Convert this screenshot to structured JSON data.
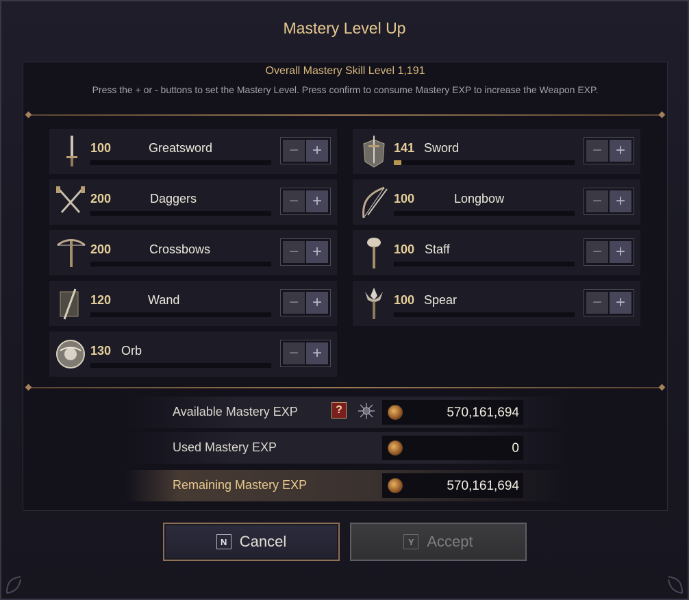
{
  "dialog": {
    "title": "Mastery Level Up",
    "overall_label": "Overall Mastery Skill Level 1,191",
    "description": "Press the + or - buttons to set the Mastery Level. Press confirm to consume Mastery EXP to increase the Weapon EXP."
  },
  "weapons": [
    {
      "level": "100",
      "name": "Greatsword",
      "icon": "greatsword-icon",
      "progress": 0
    },
    {
      "level": "141",
      "name": "Sword",
      "icon": "sword-icon",
      "progress": 0.04
    },
    {
      "level": "200",
      "name": "Daggers",
      "icon": "daggers-icon",
      "progress": 0
    },
    {
      "level": "100",
      "name": "Longbow",
      "icon": "longbow-icon",
      "progress": 0
    },
    {
      "level": "200",
      "name": "Crossbows",
      "icon": "crossbow-icon",
      "progress": 0
    },
    {
      "level": "100",
      "name": "Staff",
      "icon": "staff-icon",
      "progress": 0
    },
    {
      "level": "120",
      "name": "Wand",
      "icon": "wand-icon",
      "progress": 0
    },
    {
      "level": "100",
      "name": "Spear",
      "icon": "spear-icon",
      "progress": 0
    },
    {
      "level": "130",
      "name": "Orb",
      "icon": "orb-icon",
      "progress": 0
    }
  ],
  "buttons": {
    "minus": "−",
    "plus": "+"
  },
  "exp": {
    "available_label": "Available Mastery EXP",
    "available_value": "570,161,694",
    "help": "?",
    "used_label": "Used Mastery EXP",
    "used_value": "0",
    "remaining_label": "Remaining Mastery EXP",
    "remaining_value": "570,161,694"
  },
  "actions": {
    "cancel_key": "N",
    "cancel_label": "Cancel",
    "accept_key": "Y",
    "accept_label": "Accept"
  },
  "colors": {
    "accent": "#e8c98f",
    "panel": "#1c1b26"
  }
}
